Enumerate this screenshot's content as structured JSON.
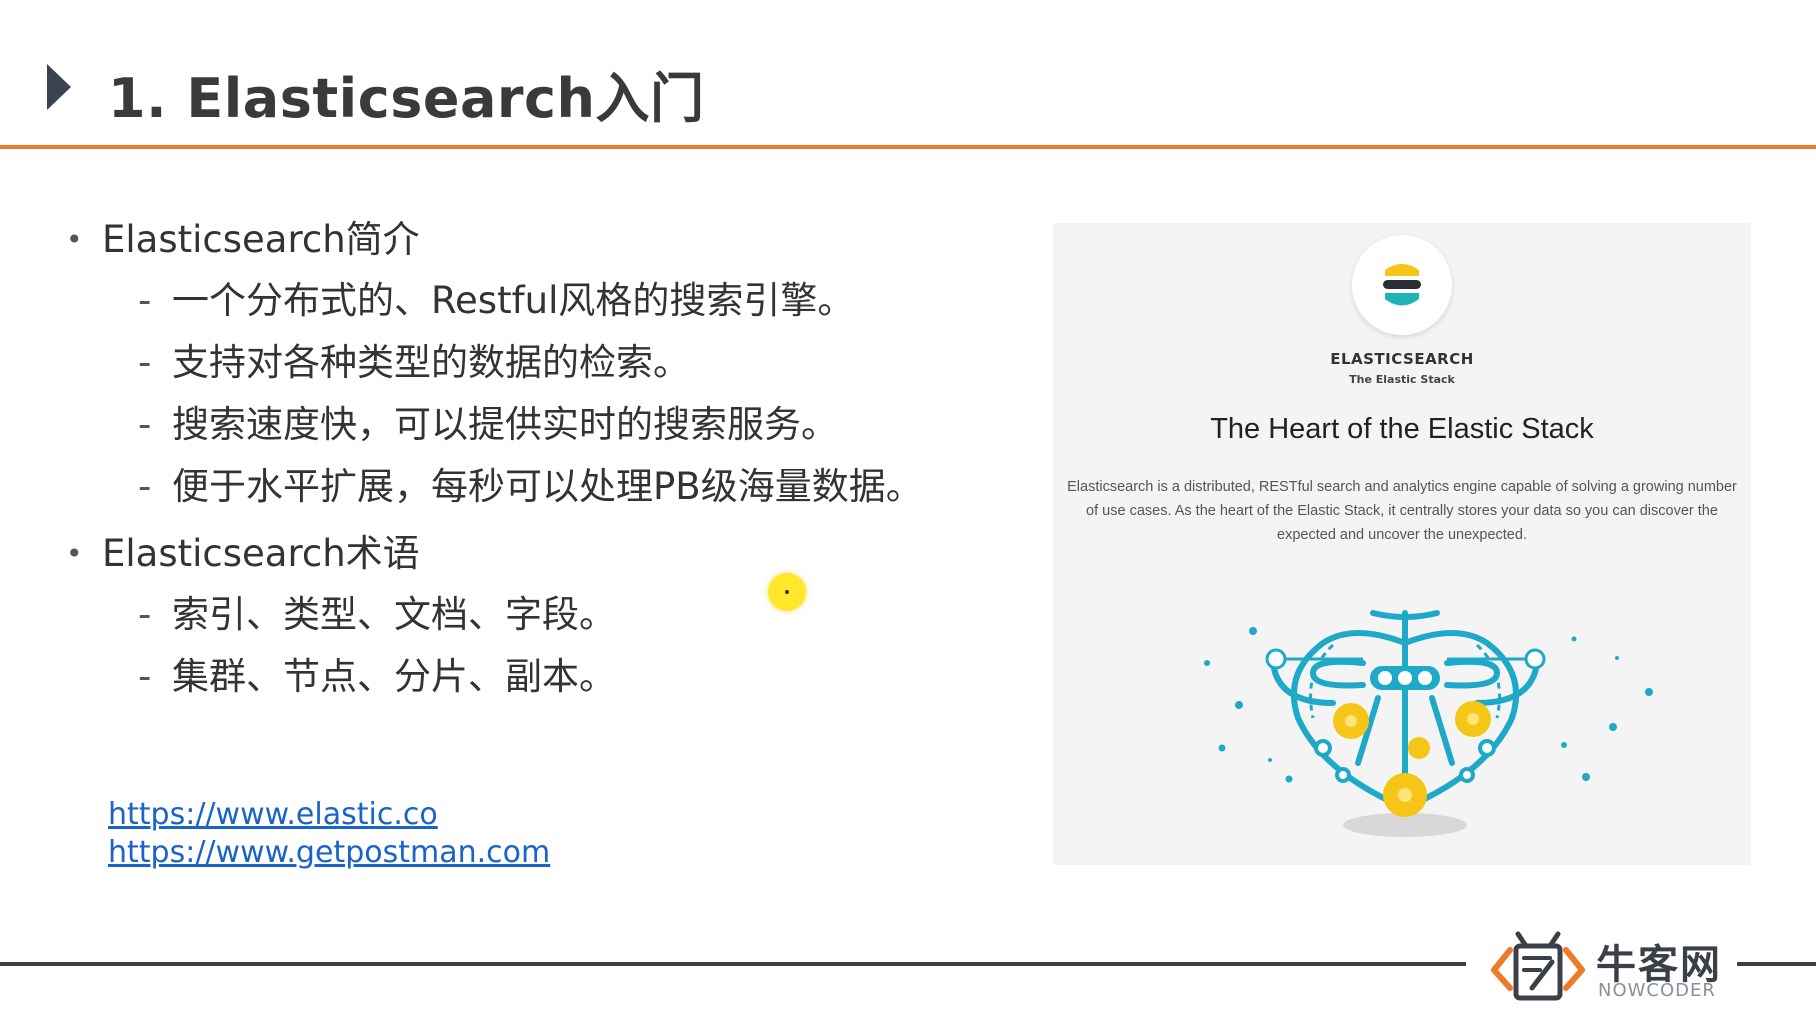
{
  "header": {
    "title": "1. Elasticsearch入门"
  },
  "bullets": [
    {
      "label": "Elasticsearch简介",
      "items": [
        "一个分布式的、Restful风格的搜索引擎。",
        "支持对各种类型的数据的检索。",
        "搜索速度快，可以提供实时的搜索服务。",
        "便于水平扩展，每秒可以处理PB级海量数据。"
      ]
    },
    {
      "label": "Elasticsearch术语",
      "items": [
        "索引、类型、文档、字段。",
        "集群、节点、分片、副本。"
      ]
    }
  ],
  "links": [
    "https://www.elastic.co",
    "https://www.getpostman.com"
  ],
  "panel": {
    "brand": "ELASTICSEARCH",
    "subbrand": "The Elastic Stack",
    "heading": "The Heart of the Elastic Stack",
    "description": "Elasticsearch is a distributed, RESTful search and analytics engine capable of solving a growing number of use cases. As the heart of the Elastic Stack, it centrally stores your data so you can discover the expected and uncover the unexpected."
  },
  "footer": {
    "brand_cn": "牛客网",
    "brand_en": "NOWCODER"
  },
  "colors": {
    "accent_rule": "#f07a2a",
    "link": "#1a63c8",
    "teal": "#1fa9c8",
    "yellow": "#f5c518",
    "footer_dark": "#3a3f48"
  },
  "icons": {
    "title_marker": "play-triangle-icon",
    "elastic_logo": "elasticsearch-logo-icon",
    "nowcoder_logo": "nowcoder-logo-icon",
    "cursor": "cursor-highlight-icon"
  }
}
